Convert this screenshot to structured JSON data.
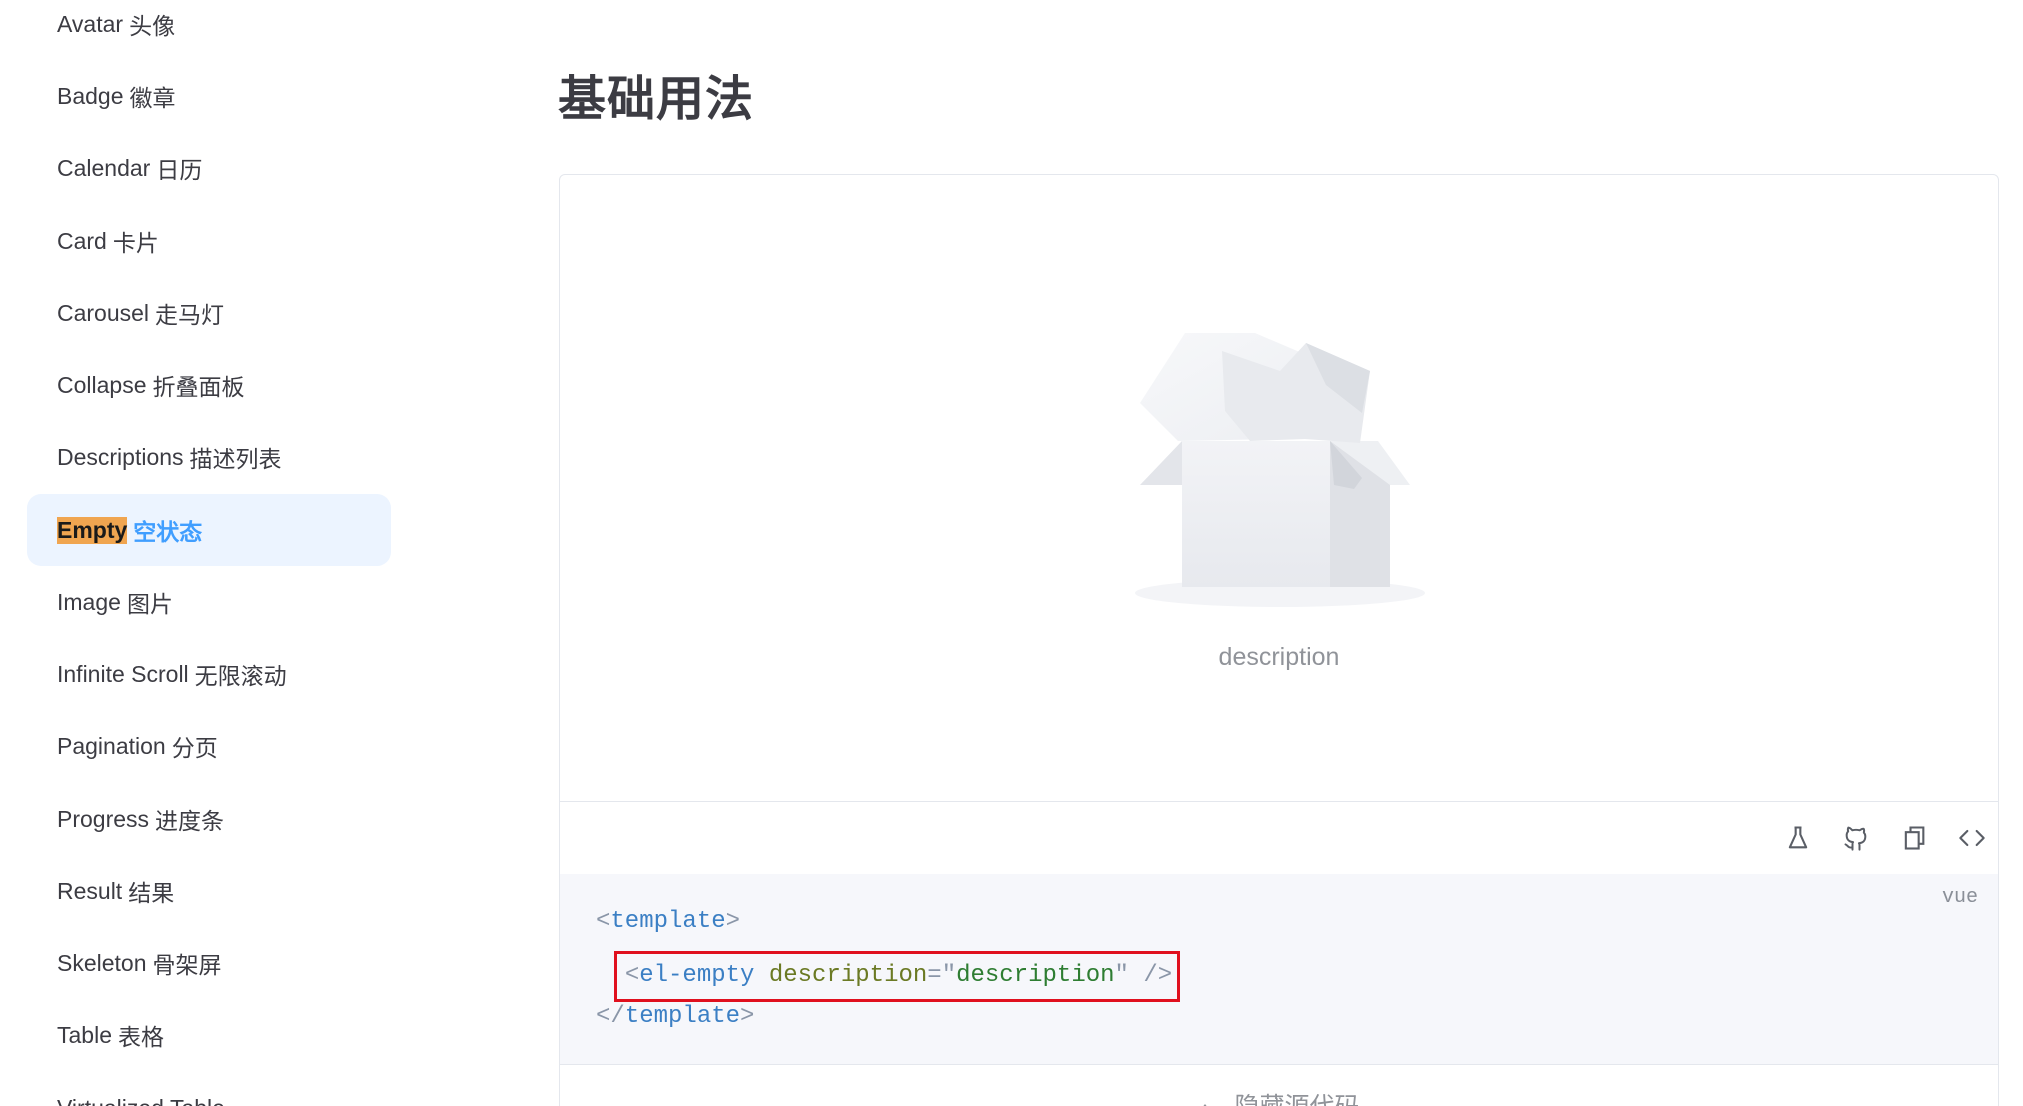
{
  "sidebar": {
    "items": [
      {
        "en": "Avatar",
        "cn": "头像"
      },
      {
        "en": "Badge",
        "cn": "徽章"
      },
      {
        "en": "Calendar",
        "cn": "日历"
      },
      {
        "en": "Card",
        "cn": "卡片"
      },
      {
        "en": "Carousel",
        "cn": "走马灯"
      },
      {
        "en": "Collapse",
        "cn": "折叠面板"
      },
      {
        "en": "Descriptions",
        "cn": "描述列表"
      },
      {
        "en": "Empty",
        "cn": "空状态"
      },
      {
        "en": "Image",
        "cn": "图片"
      },
      {
        "en": "Infinite Scroll",
        "cn": "无限滚动"
      },
      {
        "en": "Pagination",
        "cn": "分页"
      },
      {
        "en": "Progress",
        "cn": "进度条"
      },
      {
        "en": "Result",
        "cn": "结果"
      },
      {
        "en": "Skeleton",
        "cn": "骨架屏"
      },
      {
        "en": "Table",
        "cn": "表格"
      },
      {
        "en": "Virtualized Table",
        "cn": ""
      }
    ],
    "active_index": 7
  },
  "main": {
    "title": "基础用法",
    "demo": {
      "empty_description": "description",
      "toolbar": [
        "flask-icon",
        "github-icon",
        "copy-icon",
        "code-icon"
      ],
      "code_lang": "vue",
      "code": {
        "line1": {
          "open": "<",
          "tag": "template",
          "close": ">"
        },
        "line2": {
          "indent": "  ",
          "open": "<",
          "tag": "el-empty",
          "attr": "description",
          "eq": "=",
          "q1": "\"",
          "val": "description",
          "q2": "\"",
          "close": " />"
        },
        "line3": {
          "open": "</",
          "tag": "template",
          "close": ">"
        }
      },
      "hide_label": "隐藏源代码"
    }
  },
  "colors": {
    "accent": "#409eff",
    "active_bg": "#ecf4ff",
    "highlight": "#f0a550",
    "annotation": "#e0101e"
  }
}
